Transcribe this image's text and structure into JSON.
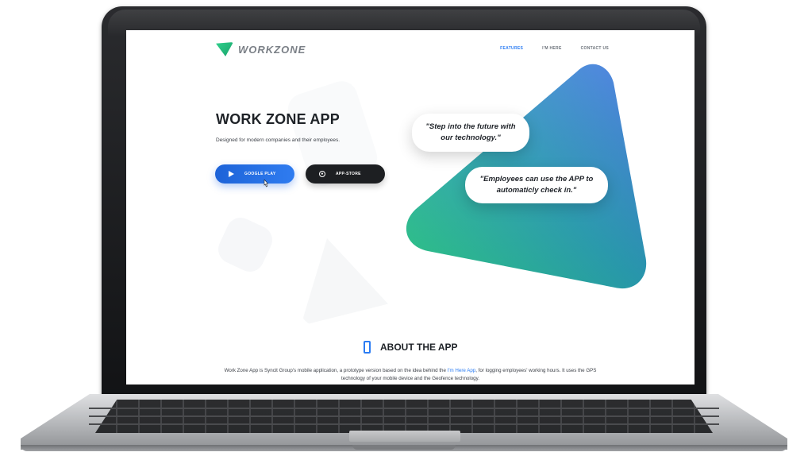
{
  "brand": {
    "name": "WORKZONE"
  },
  "nav": {
    "items": [
      "FEATURES",
      "I'M HERE",
      "CONTACT US"
    ],
    "active": "FEATURES"
  },
  "hero": {
    "title": "WORK ZONE APP",
    "subtitle": "Designed for modern companies and their employees.",
    "google_label": "GOOGLE PLAY",
    "apple_label": "APP-STORE"
  },
  "bubbles": {
    "first": "\"Step into the future with our technology.\"",
    "second": "\"Employees can use the APP to automaticly check in.\""
  },
  "about": {
    "title": "ABOUT THE APP",
    "text_before_link": "Work Zone App is Syncit Group's mobile application, a prototype version based on the idea behind the ",
    "link": "I'm Here App",
    "text_after_link": ", for logging employees' working hours. It uses the GPS technology of your mobile device and the Geofence technology."
  },
  "colors": {
    "accent": "#2b7cf3",
    "brand_green": "#2fd08c",
    "gradient_start": "#2fd48a",
    "gradient_end": "#3b6fe0",
    "button_dark": "#1d1f22"
  },
  "icons": [
    "logo-icon",
    "play-icon",
    "apple-icon",
    "mouse-cursor-icon",
    "smartphone-icon"
  ]
}
